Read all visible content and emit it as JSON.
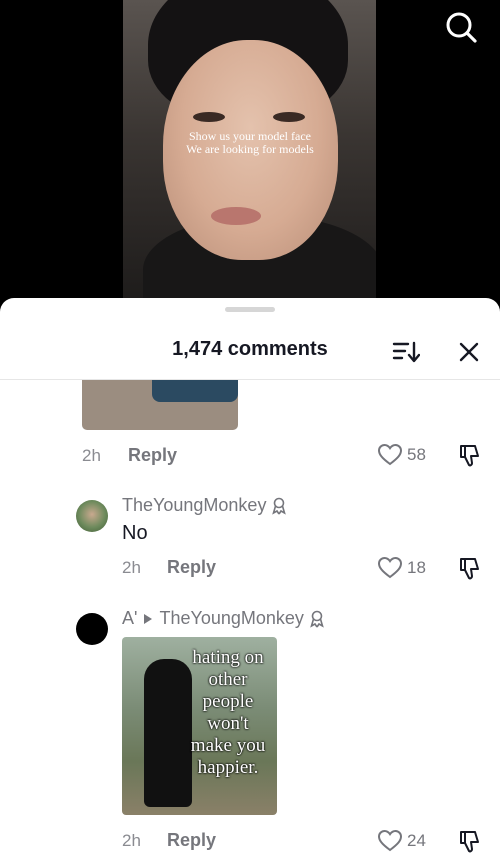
{
  "video": {
    "caption_line1": "Show us your model face",
    "caption_line2": "We are looking for models"
  },
  "comments_sheet": {
    "title": "1,474 comments"
  },
  "comments": [
    {
      "time": "2h",
      "reply_label": "Reply",
      "likes": "58"
    },
    {
      "username": "TheYoungMonkey",
      "text": "No",
      "time": "2h",
      "reply_label": "Reply",
      "likes": "18"
    },
    {
      "username": "A'",
      "reply_to": "TheYoungMonkey",
      "time": "2h",
      "reply_label": "Reply",
      "likes": "24",
      "image_text": [
        "hating on",
        "other",
        "people",
        "won't",
        "make you",
        "happier."
      ]
    }
  ],
  "colors": {
    "sheet_bg": "#ffffff",
    "text_primary": "#161823",
    "text_secondary": "#75767c"
  }
}
